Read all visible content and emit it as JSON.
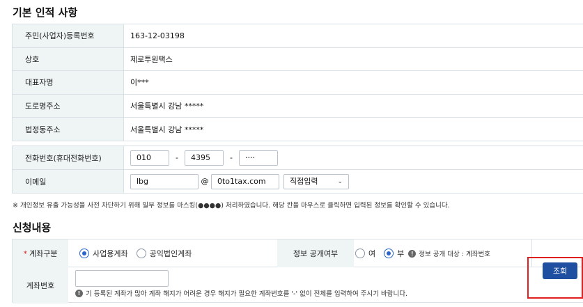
{
  "basic": {
    "title": "기본 인적 사항",
    "rows": [
      {
        "label": "주민(사업자)등록번호",
        "value": "163-12-03198"
      },
      {
        "label": "상호",
        "value": "제로투원택스"
      },
      {
        "label": "대표자명",
        "value": "이***"
      },
      {
        "label": "도로명주소",
        "value": "서울특별시 강남 *****"
      },
      {
        "label": "법정동주소",
        "value": "서울특별시 강남 *****"
      }
    ]
  },
  "contact": {
    "phone_label": "전화번호(휴대전화번호)",
    "phone1": "010",
    "phone2": "4395",
    "phone3": "····",
    "dash": "-",
    "email_label": "이메일",
    "email_id": "lbg",
    "at": "@",
    "email_domain": "0to1tax.com",
    "domain_select": "직접입력"
  },
  "notice": "※ 개인정보 유출 가능성을 사전 차단하기 위해 일부 정보를 마스킹(●●●●) 처리하였습니다. 해당 칸을 마우스로 클릭하면 입력된 정보를 확인할 수 있습니다.",
  "apply": {
    "title": "신청내용",
    "required_mark": "*",
    "acct_type_label": "계좌구분",
    "acct_type_options": [
      "사업용계좌",
      "공익법인계좌"
    ],
    "acct_type_selected": 0,
    "disclose_label": "정보 공개여부",
    "disclose_options": [
      "여",
      "부"
    ],
    "disclose_selected": 1,
    "disclose_info": "정보 공개 대상 : 계좌번호",
    "acct_no_label": "계좌번호",
    "acct_no_value": "",
    "acct_no_help": "기 등록된 계좌가 많아 계좌 해지가 어려운 경우 해지가 필요한 계좌번호를 '-' 없이 전체를 입력하여 주시기 바랍니다.",
    "query_button": "조회"
  },
  "colors": {
    "header_bg": "#eef5f4",
    "border": "#d9e0e6",
    "accent": "#2a63c9",
    "button": "#1f4fa0",
    "highlight": "#e02020"
  }
}
